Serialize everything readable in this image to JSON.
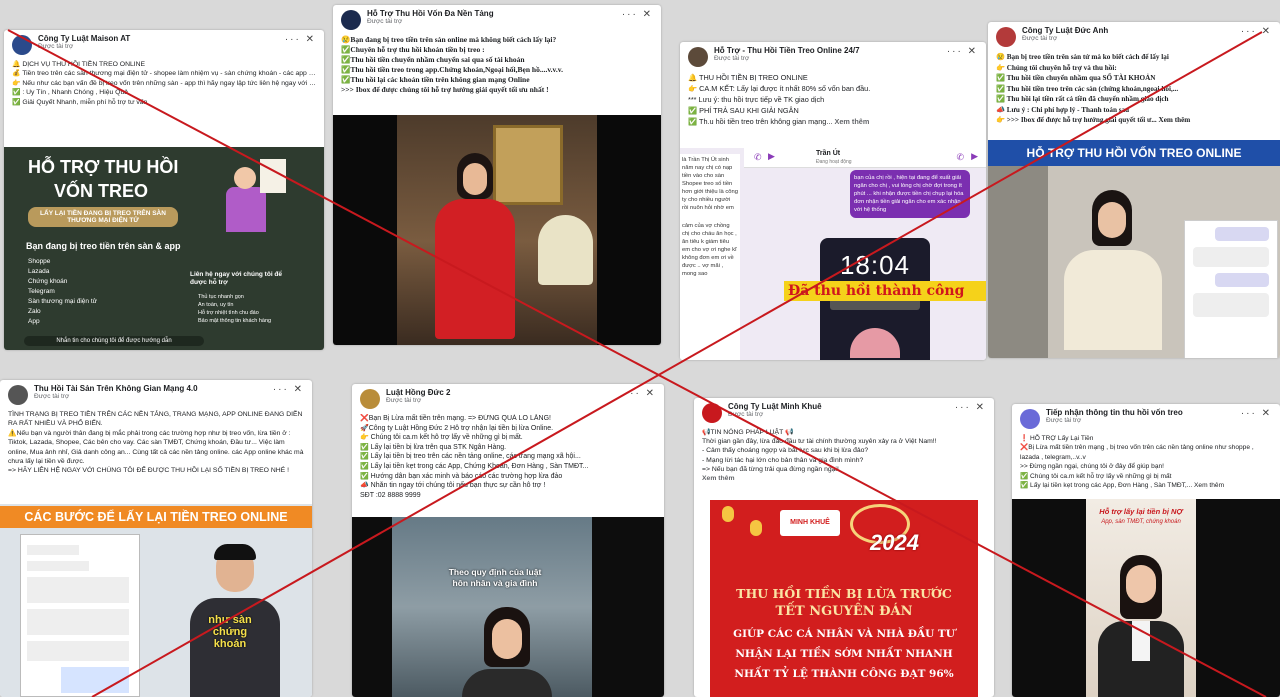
{
  "cards": [
    {
      "page": "Công Ty Luật Maison AT",
      "sponsored": "Được tài trợ",
      "lines": [
        "🔔 DỊCH VỤ THU HỒI TIỀN TREO ONLINE",
        "💰 Tiền treo trên các sàn thương mại điện tử - shopee làm nhiệm vụ - sàn chứng khoán - các app online sàn thương mại điện tử",
        "👉 Nếu như các bạn vấn đề bị treo vốn trên những sàn - app thì hãy ngay lập tức liên hệ ngay với chúng tôi để được hỗ trợ thu hồi nhận tiền về",
        "✅ : Uy Tín , Nhanh Chóng , Hiệu Quả",
        "✅ Giải Quyết Nhanh, miễn phí hỗ trợ tư vấn"
      ],
      "banner": {
        "title_1": "HỖ TRỢ THU HỒI",
        "title_2": "VỐN TREO",
        "pill": "LẤY LẠI TIỀN ĐANG BỊ TREO TRÊN SÀN THƯƠNG MẠI ĐIỆN TỬ",
        "subtitle": "Bạn đang bị treo tiền trên sàn & app",
        "list": [
          "Shoppe",
          "Lazada",
          "Chứng khoán",
          "Telegram",
          "Sàn thương mại điện tử",
          "Zalo",
          "App"
        ],
        "contact": "Liên hệ ngay với chúng tôi để được hỗ trợ",
        "steps": [
          "Thủ tục nhanh gọn",
          "An toàn, uy tín",
          "Hỗ trợ nhiệt tình chu đáo",
          "Bảo mật thông tin khách hàng"
        ],
        "footer": "Nhắn tin cho chúng tôi để được hướng dẫn"
      }
    },
    {
      "page": "Hỗ Trợ Thu Hồi Vốn Đa Nền Tảng",
      "sponsored": "Được tài trợ",
      "lines": [
        "😢Bạn đang bị treo tiền trên sàn online mà không biết cách lấy lại?",
        "✅Chuyên hỗ trợ thu hồi khoản tiền bị treo :",
        "✅Thu hồi tiền chuyển nhầm chuyển sai qua số tài khoản",
        "✅Thu hồi tiền treo trong app.Chứng khoán,Ngoại hối,Bẹn hồ....v.v.v.",
        "✅Thu hồi lại các khoản tiền trên không gian mạng Online",
        ">>> Ibox để được chúng tôi hỗ trợ hướng giải quyết tối ưu nhất !"
      ]
    },
    {
      "page": "Hỗ Trợ - Thu Hồi Tiền Treo Online 24/7",
      "sponsored": "Được tài trợ",
      "lines": [
        "🔔 THU HỒI TIỀN BỊ TREO ONLINE",
        "👉 CA.M KẾT: Lấy lại được ít nhất 80% số vốn ban đầu.",
        "*** Lưu ý: thu hồi trực tiếp về TK giao dịch",
        "✅ PHÍ TRẢ SAU KHI GIẢI NGÂN",
        "✅ Th.u hồi tiền treo trên không gian mạng..."
      ],
      "more": "Xem thêm",
      "chat_name": "Trần Út",
      "chat_status": "Đang hoạt động",
      "chat_left": "là Trần Thị Út sinh năm nay chị có nạp tiền vào cho sàn Shopee treo số tiền hơn giới thiệu là công ty cho nhiều người rồi nuôn hỏi nhờ em",
      "chat_right": "bạn của chị rồi , hiện tại đang để xuất giải ngân cho chị , vui lòng chị chờ đợi trong ít phút ... khi nhận được tiền chị chụp lại hóa đơn nhận tiền giải ngân cho em xác nhận với hệ thống",
      "chat_left2": "cảm của vợ chồng chị cho cháu ăn học , ăn tiêu k giám tiêu em cho vợ ơi nghe kĩ không đơn em ơi về được .. vợ mãi , mong sao",
      "clock": "18:04",
      "banner": "Đã thu hồi thành công"
    },
    {
      "page": "Công Ty Luật Đức Anh",
      "sponsored": "Được tài trợ",
      "lines": [
        "😢 Bạn bị treo tiền trên sàn tử mà ko biết cách để lấy lại",
        "👉 Chúng tôi chuyên hỗ trợ và thu hồi:",
        "✅ Thu hồi tiền chuyển nhầm qua SỐ TÀI KHOẢN",
        "✅ Thu hồi tiền treo trên các sàn (chứng khoán,ngoại hối,...",
        "✅ Thu hồi lại tiền rất cả tiền đã chuyển nhầm giao dịch",
        "📣 Lưu ý : Chi phí hợp lý - Thanh toán sau",
        "👉 >>> Ibox để được hỗ trợ hướng giải quyết tối ư... Xem thêm"
      ],
      "banner": "HỖ TRỢ THU HỒI VỐN TREO ONLINE"
    },
    {
      "page": "Thu Hồi Tài Sản Trên Không Gian Mạng 4.0",
      "sponsored": "Được tài trợ",
      "lines": [
        "TÌNH TRẠNG BỊ TREO TIỀN TRÊN CÁC NỀN TẢNG, TRANG MẠNG, APP ONLINE ĐANG DIỄN RA RẤT NHIỀU VÀ PHỔ BIẾN.",
        "⚠️Nếu bạn và người thân đang bị mắc phải trong các trường hợp như bị treo vốn, lừa tiền ở : Tiktok, Lazada, Shopee, Các bên cho vay. Các sàn TMĐT, Chứng khoán, Đầu tư... Việc làm online, Mua ảnh nhỉ, Giả danh công an... Cùng tất cả các nền tảng online. các App online khác mà chưa lấy lại tiền về được.",
        "=> HÃY LIÊN HỆ NGAY VỚI CHÚNG TÔI ĐỂ ĐƯỢC THU HỒI LẠI SỐ TIỀN BỊ TREO NHÉ !"
      ],
      "banner": "CÁC BƯỚC ĐỂ LẤY LẠI TIỀN TREO ONLINE",
      "caption": "như sàn chứng khoán"
    },
    {
      "page": "Luật Hồng Đức 2",
      "sponsored": "Được tài trợ",
      "lines": [
        "❌Bạn Bị Lừa mất tiền trên mạng. => ĐỪNG QUÁ LO LẮNG!",
        "🚀Công ty Luật Hồng Đức 2 Hỗ trợ nhận lại tiền bị lừa Online.",
        "👉 Chúng tôi ca.m kết hỗ trợ lấy về những gì bị mất.",
        "✅ Lấy lại tiền bị lừa trên qua STK Ngân Hàng.",
        "✅ Lấy lại tiền bị treo trên các nền tảng online, các trang mạng xã hội...",
        "✅ Lấy lại tiền kẹt trong các App, Chứng Khoán, Đơn Hàng , Sàn TMĐT...",
        "✅ Hướng dẫn bạn xác minh và báo cáo các trường hợp lừa đảo",
        "📣 Nhắn tin ngay tới chúng tôi nếu bạn thực sự cần hỗ trợ !",
        "SĐT :02 8888 9999"
      ],
      "caption": "Theo quy định của luật hôn nhân và gia đình"
    },
    {
      "page": "Công Ty Luật Minh Khuê",
      "sponsored": "Được tài trợ",
      "lines": [
        "📢TIN NÓNG PHÁP LUẬT 📢",
        "Thời gian gần đây, lừa đảo đầu tư tài chính thường xuyên xảy ra ở Việt Nam!!",
        "- Cảm thấy choáng ngợp và bất lực sau khi bị lừa đảo?",
        "- Mạng lừi tác hại lớn cho bản thân và gia đình mình?",
        "=> Nếu bạn đã từng trải qua đừng ngần ngại!",
        "Xem thêm"
      ],
      "brand": "MINH KHUÊ",
      "year": "2024",
      "headline_1": "THU HỒI TIỀN BỊ LỪA TRƯỚC",
      "headline_2": "TẾT NGUYÊN ĐÁN",
      "sub_1": "GIÚP CÁC CÁ NHÂN VÀ NHÀ ĐẦU TƯ",
      "sub_2": "NHẬN LẠI TIỀN SỚM NHẤT NHANH",
      "sub_3": "NHẤT TỶ LỆ THÀNH CÔNG ĐẠT 96%"
    },
    {
      "page": "Tiếp nhận thông tin thu hồi vốn treo",
      "sponsored": "Được tài trợ",
      "lines": [
        "❗ HỖ TRỢ Lấy Lại Tiền",
        "❌Bị Lừa mất tiền trên mạng , bị treo vốn trên các nền tảng online như shoppe , lazada , telegram,..v..v",
        ">> Đừng ngần ngại, chúng tôi ở đây để giúp bạn!",
        "✅ Chúng tôi ca.m kết hỗ trợ lấy về những gì bị mất",
        "✅ Lấy lại tiền kẹt trong các App, Đơn Hàng , Sàn TMĐT,... Xem thêm"
      ],
      "banner_1": "Hỗ trợ lấy lại tiền bị NỢ",
      "banner_2": "App, sàn TMĐT, chứng khoán"
    }
  ],
  "controls": {
    "menu": "···",
    "close": "✕"
  },
  "colors": {
    "cross": "#c8191e",
    "red_banner": "#d21e1e",
    "dark_green": "#2e3b2f"
  }
}
